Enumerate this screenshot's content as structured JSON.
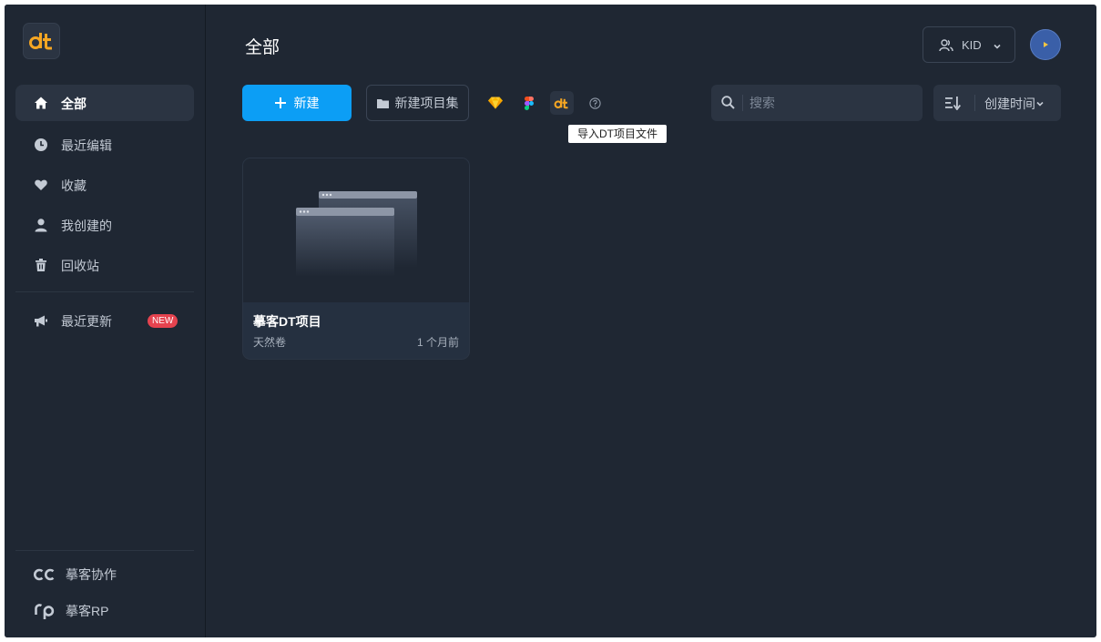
{
  "sidebar": {
    "logo_text": "dt",
    "items": [
      {
        "label": "全部",
        "icon": "home-icon",
        "active": true
      },
      {
        "label": "最近编辑",
        "icon": "clock-icon"
      },
      {
        "label": "收藏",
        "icon": "heart-icon"
      },
      {
        "label": "我创建的",
        "icon": "user-icon"
      },
      {
        "label": "回收站",
        "icon": "trash-icon"
      }
    ],
    "updates": {
      "label": "最近更新",
      "icon": "megaphone-icon",
      "badge": "NEW"
    },
    "external": [
      {
        "label": "摹客协作",
        "icon": "cc-logo-icon"
      },
      {
        "label": "摹客RP",
        "icon": "rp-logo-icon"
      }
    ]
  },
  "header": {
    "title": "全部",
    "team_label": "KID"
  },
  "toolbar": {
    "new_label": "新建",
    "new_collection_label": "新建项目集",
    "import_icons": [
      "sketch-icon",
      "figma-icon",
      "dt-import-icon",
      "help-icon"
    ],
    "tooltip": "导入DT项目文件",
    "search_placeholder": "搜索",
    "sort_label": "创建时间"
  },
  "projects": [
    {
      "name": "摹客DT项目",
      "owner": "天然卷",
      "time": "1 个月前"
    }
  ],
  "colors": {
    "background": "#1f2733",
    "panel": "#2b3442",
    "accent": "#0c9ef5",
    "logo_orange": "#f5a623",
    "badge_red": "#e5434f"
  }
}
